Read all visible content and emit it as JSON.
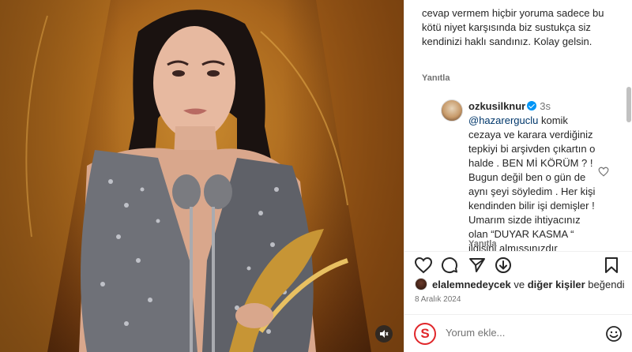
{
  "post": {
    "media_alt_icon": "mute-icon"
  },
  "comments": {
    "previous_comment_text": "cevap vermem hiçbir yoruma sadece bu kötü niyet karşısında biz sustukça siz kendinizi haklı sandınız. Kolay gelsin.",
    "previous_reply_label": "Yanıtla",
    "comment": {
      "username": "ozkusilknur",
      "time": "3s",
      "mention": "@hazarerguclu",
      "text": " komik cezaya ve karara verdiğiniz tepkiyi bi arşivden çıkartın o halde . BEN Mİ KÖRÜM ? ! Bugun değil ben o gün de aynı şeyi söyledim . Her kişi kendinden bilir işi demişler ! Umarım sizde ihtiyacınız olan “DUYAR KASMA “ ilgisini almışsınızdır ödülünüz ile beraber !",
      "reply_label": "Yanıtla"
    }
  },
  "actions": {
    "like_icon": "heart-icon",
    "comment_icon": "comment-icon",
    "share_icon": "share-icon",
    "save_icon": "bookmark-icon"
  },
  "likes": {
    "first_user": "elalemnedeycek",
    "connector": " ve ",
    "others": "diğer kişiler",
    "suffix": " beğendi"
  },
  "date": "8 Aralık 2024",
  "composer": {
    "placeholder": "Yorum ekle...",
    "avatar_letter": "S"
  },
  "colors": {
    "verified": "#0095f6",
    "accent_red": "#e0262a"
  }
}
